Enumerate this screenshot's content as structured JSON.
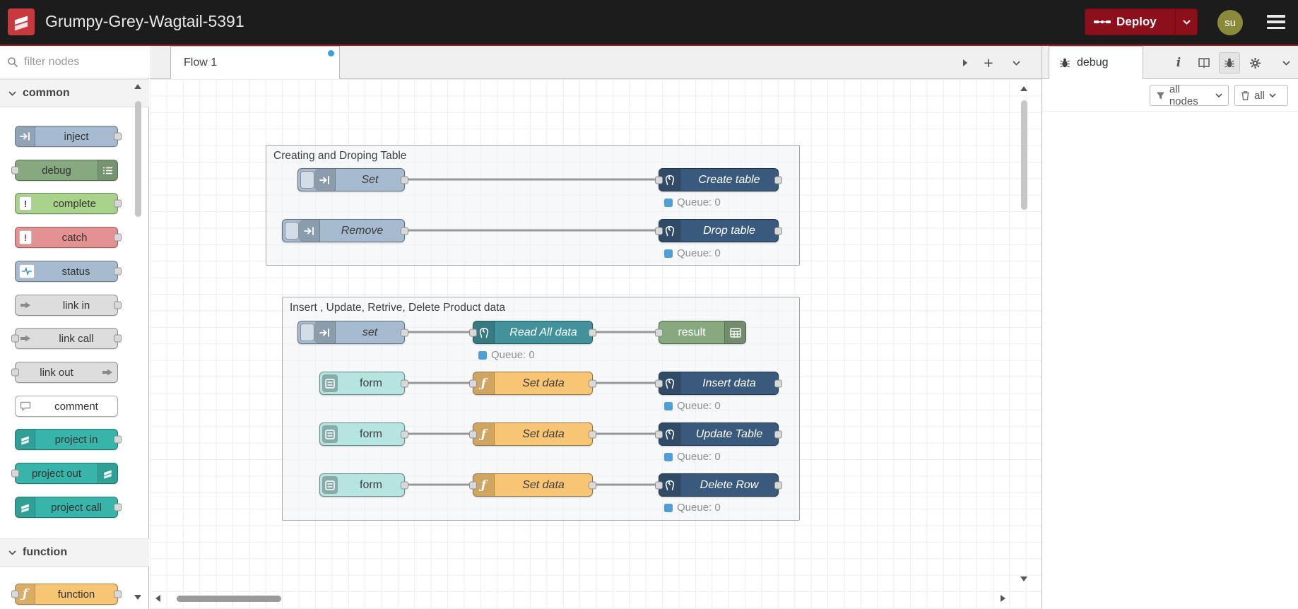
{
  "header": {
    "title": "Grumpy-Grey-Wagtail-5391",
    "deploy": {
      "label": "Deploy"
    },
    "user": {
      "initials": "su"
    }
  },
  "colors": {
    "header_bg": "#1c1c1c",
    "accent_line": "#9e1a22",
    "deploy_red": "#8C101C",
    "logo_red": "#c8393d",
    "inject": "#a6bbcf",
    "debug": "#87a980",
    "complete": "#a9d38b",
    "catch": "#e49191",
    "status": "#a6bbcf",
    "link": "#dddddd",
    "comment": "#ffffff",
    "project": "#37b5aa",
    "function": "#f7c573",
    "postgres_dark": "#3a5a7d",
    "postgres_teal": "#42929b",
    "form": "#b5e4e1",
    "queue_dot": "#4f9ed7",
    "tab_modified_dot": "#35a2de"
  },
  "palette": {
    "filter_placeholder": "filter nodes",
    "categories": [
      {
        "label": "common"
      },
      {
        "label": "function"
      }
    ],
    "items": {
      "inject": {
        "label": "inject"
      },
      "debug": {
        "label": "debug"
      },
      "complete": {
        "label": "complete"
      },
      "catch": {
        "label": "catch"
      },
      "status": {
        "label": "status"
      },
      "link_in": {
        "label": "link in"
      },
      "link_call": {
        "label": "link call"
      },
      "link_out": {
        "label": "link out"
      },
      "comment": {
        "label": "comment"
      },
      "project_in": {
        "label": "project in"
      },
      "project_out": {
        "label": "project out"
      },
      "project_call": {
        "label": "project call"
      },
      "function": {
        "label": "function"
      }
    }
  },
  "workspace": {
    "tab": {
      "label": "Flow 1"
    },
    "groups": [
      {
        "title": "Creating and Droping Table"
      },
      {
        "title": "Insert , Update, Retrive, Delete Product data"
      }
    ],
    "nodes": {
      "set1": {
        "label": "Set"
      },
      "remove": {
        "label": "Remove"
      },
      "create_table": {
        "label": "Create table",
        "status": "Queue: 0"
      },
      "drop_table": {
        "label": "Drop table",
        "status": "Queue: 0"
      },
      "set2": {
        "label": "set"
      },
      "read_all": {
        "label": "Read All data",
        "status": "Queue: 0"
      },
      "result": {
        "label": "result"
      },
      "form1": {
        "label": "form"
      },
      "form2": {
        "label": "form"
      },
      "form3": {
        "label": "form"
      },
      "setdata1": {
        "label": "Set data"
      },
      "setdata2": {
        "label": "Set data"
      },
      "setdata3": {
        "label": "Set data"
      },
      "insert_data": {
        "label": "Insert data",
        "status": "Queue: 0"
      },
      "update_table": {
        "label": "Update Table",
        "status": "Queue: 0"
      },
      "delete_row": {
        "label": "Delete Row",
        "status": "Queue: 0"
      }
    }
  },
  "debug_panel": {
    "tab_label": "debug",
    "filter_button": "all nodes",
    "clear_button": "all"
  }
}
